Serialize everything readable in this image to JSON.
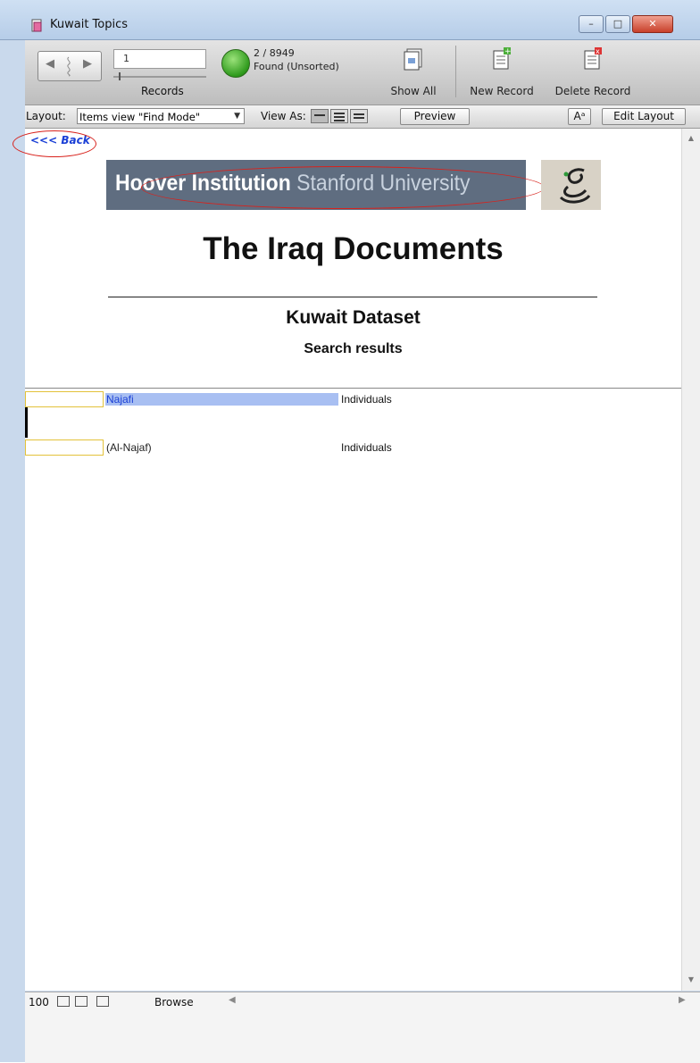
{
  "window": {
    "title": "Kuwait Topics",
    "controls": {
      "minimize": "–",
      "maximize": "□",
      "close": "✕"
    }
  },
  "toolbar": {
    "record_number": "1",
    "records_label": "Records",
    "found_count": "2 / 8949",
    "found_state": "Found (Unsorted)",
    "show_all_label": "Show All",
    "new_record_label": "New Record",
    "delete_record_label": "Delete Record"
  },
  "layout_bar": {
    "layout_label": "Layout:",
    "layout_value": "Items view \"Find Mode\"",
    "view_as_label": "View As:",
    "preview_label": "Preview",
    "text_format_label": "Aᵃ",
    "edit_layout_label": "Edit Layout"
  },
  "content": {
    "back_link": "<<< Back",
    "banner_bold": "Hoover Institution",
    "banner_light": "Stanford University",
    "title": "The Iraq Documents",
    "subtitle": "Kuwait Dataset",
    "subsubtitle": "Search results",
    "rows": [
      {
        "name": "Najafi",
        "category": "Individuals"
      },
      {
        "name": "(Al-Najaf)",
        "category": "Individuals"
      }
    ]
  },
  "statusbar": {
    "zoom": "100",
    "mode": "Browse"
  },
  "colors": {
    "annotation": "#d8221c",
    "link": "#1a3fd6",
    "selection": "#a8bff2",
    "banner": "#5f6d80"
  }
}
